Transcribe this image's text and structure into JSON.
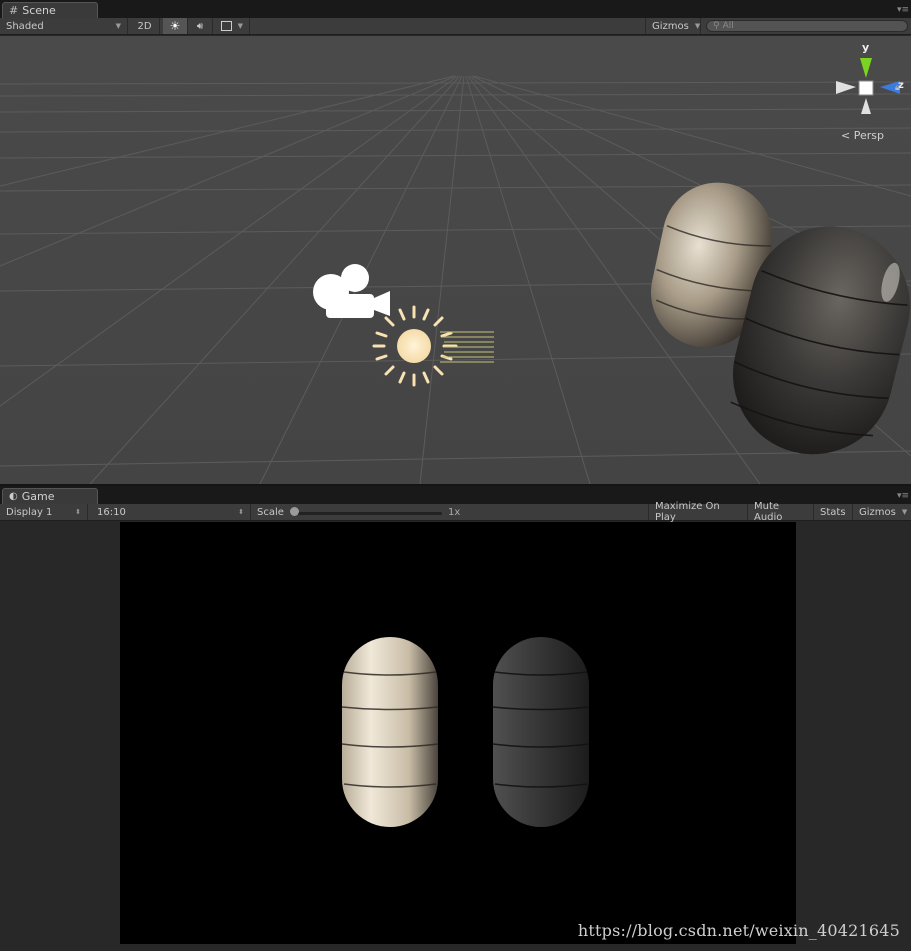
{
  "scene_panel": {
    "tab_label": "Scene",
    "toolbar": {
      "draw_mode": "Shaded",
      "mode_2d": "2D",
      "gizmos_label": "Gizmos",
      "search_placeholder": "All"
    },
    "gizmo": {
      "axis_y": "y",
      "axis_z": "z",
      "projection_label": "Persp"
    }
  },
  "game_panel": {
    "tab_label": "Game",
    "toolbar": {
      "display": "Display 1",
      "aspect": "16:10",
      "scale_label": "Scale",
      "scale_value": "1x",
      "scale_fraction": 0.0,
      "maximize_on_play": "Maximize On Play",
      "mute_audio": "Mute Audio",
      "stats": "Stats",
      "gizmos_label": "Gizmos"
    }
  },
  "watermark": "https://blog.csdn.net/weixin_40421645",
  "colors": {
    "panel_bg": "#282828",
    "toolbar_bg": "#3c3c3c",
    "scene_sky": "#474747",
    "game_bg": "#000000",
    "axis_y": "#7bd322",
    "axis_z": "#3a7bdd"
  }
}
